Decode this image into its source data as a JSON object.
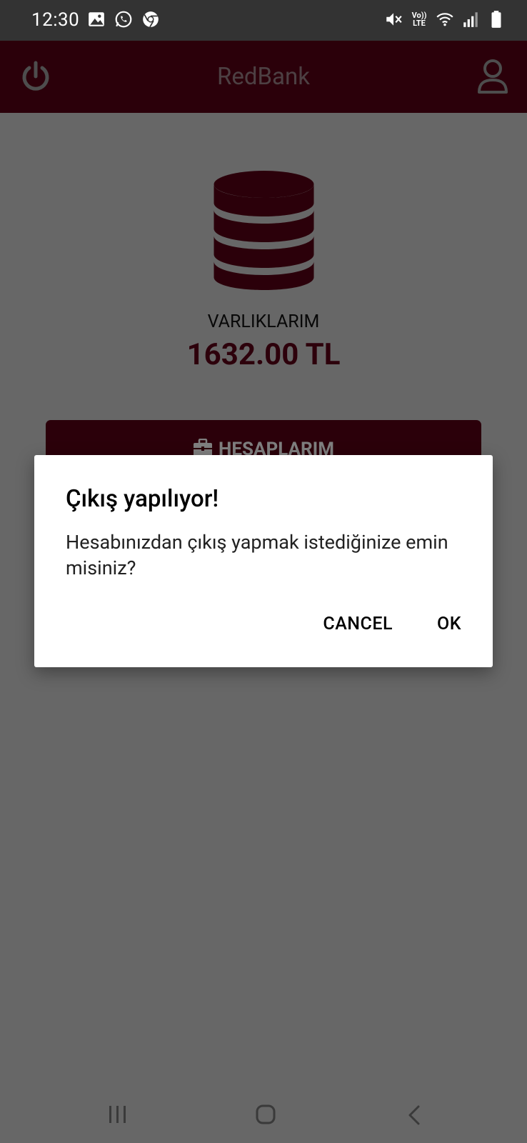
{
  "status_bar": {
    "time": "12:30",
    "left_icons": [
      "gallery-icon",
      "whatsapp-icon",
      "chrome-icon"
    ],
    "volte_text": "Vo)) LTE",
    "right_icons": [
      "mute-icon",
      "volte-icon",
      "wifi-icon",
      "signal-icon",
      "battery-icon"
    ]
  },
  "app_bar": {
    "title": "RedBank",
    "color": "#560014"
  },
  "main": {
    "assets_label": "VARLIKLARIM",
    "assets_value": "1632.00 TL",
    "accounts_button": "HESAPLARIM"
  },
  "dialog": {
    "title": "Çıkış yapılıyor!",
    "message": "Hesabınızdan çıkış yapmak istediğinize emin misiniz?",
    "cancel": "CANCEL",
    "ok": "OK"
  },
  "nav_bar": {
    "icons": [
      "recent-apps-icon",
      "home-icon",
      "back-icon"
    ]
  }
}
